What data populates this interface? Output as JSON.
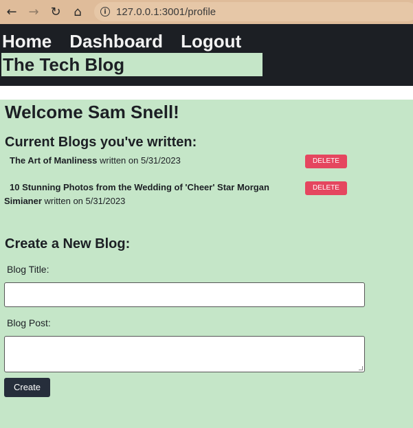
{
  "browser": {
    "back_glyph": "←",
    "forward_glyph": "→",
    "reload_glyph": "↻",
    "home_glyph": "⌂",
    "info_glyph": "i",
    "url": "127.0.0.1:3001/profile"
  },
  "header": {
    "nav": [
      "Home",
      "Dashboard",
      "Logout"
    ],
    "site_title": "The Tech Blog"
  },
  "main": {
    "welcome": "Welcome Sam Snell!",
    "blogs_heading": "Current Blogs you've written:",
    "blogs": [
      {
        "title": "The Art of Manliness",
        "meta": "written on 5/31/2023",
        "delete_label": "DELETE"
      },
      {
        "title_part1": "10 Stunning Photos from the Wedding of 'Cheer' Star Morgan",
        "title_part2": "Simianer",
        "meta": "written on 5/31/2023",
        "delete_label": "DELETE"
      }
    ],
    "create_heading": "Create a New Blog:",
    "blog_title_label": "Blog Title:",
    "blog_title_value": "",
    "blog_post_label": "Blog Post:",
    "blog_post_value": "",
    "create_label": "Create"
  },
  "colors": {
    "browser_bar": "#dfbc9a",
    "header_bg": "#1c1f24",
    "content_bg": "#c5e6c8",
    "delete_button": "#e5465f",
    "create_button": "#262e3b"
  }
}
